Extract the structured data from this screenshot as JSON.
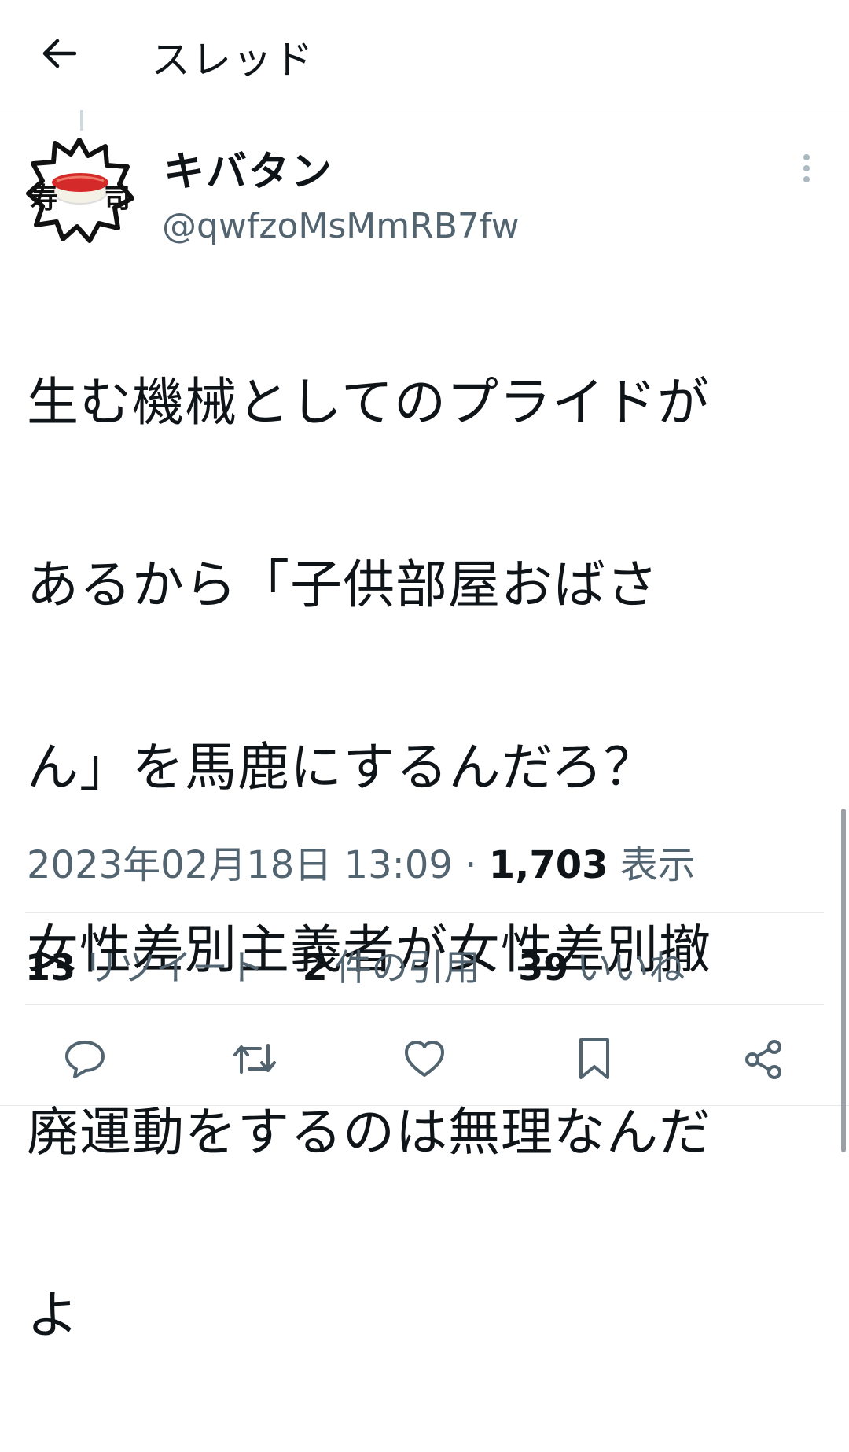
{
  "header": {
    "title": "スレッド",
    "back_icon": "arrow-left-icon"
  },
  "author": {
    "name": "キバタン",
    "handle": "@qwfzoMsMmRB7fw",
    "avatar_text": "寿司"
  },
  "tweet": {
    "lines": [
      "生む機械としてのプライドが",
      "あるから「子供部屋おばさ",
      "ん」を馬鹿にするんだろ？",
      "女性差別主義者が女性差別撤",
      "廃運動をするのは無理なんだ",
      "よ"
    ]
  },
  "meta": {
    "timestamp": "2023年02月18日 13:09",
    "separator": "·",
    "views_count": "1,703",
    "views_label": "表示"
  },
  "stats": {
    "retweets_count": "13",
    "retweets_label": "リツイート",
    "quotes_count": "2",
    "quotes_label": "件の引用",
    "likes_count": "39",
    "likes_label": "いいね"
  },
  "actions": [
    "reply-icon",
    "retweet-icon",
    "like-icon",
    "bookmark-icon",
    "share-icon"
  ],
  "colors": {
    "text": "#0f1419",
    "secondary": "#536471",
    "divider": "#e6e9eb"
  }
}
